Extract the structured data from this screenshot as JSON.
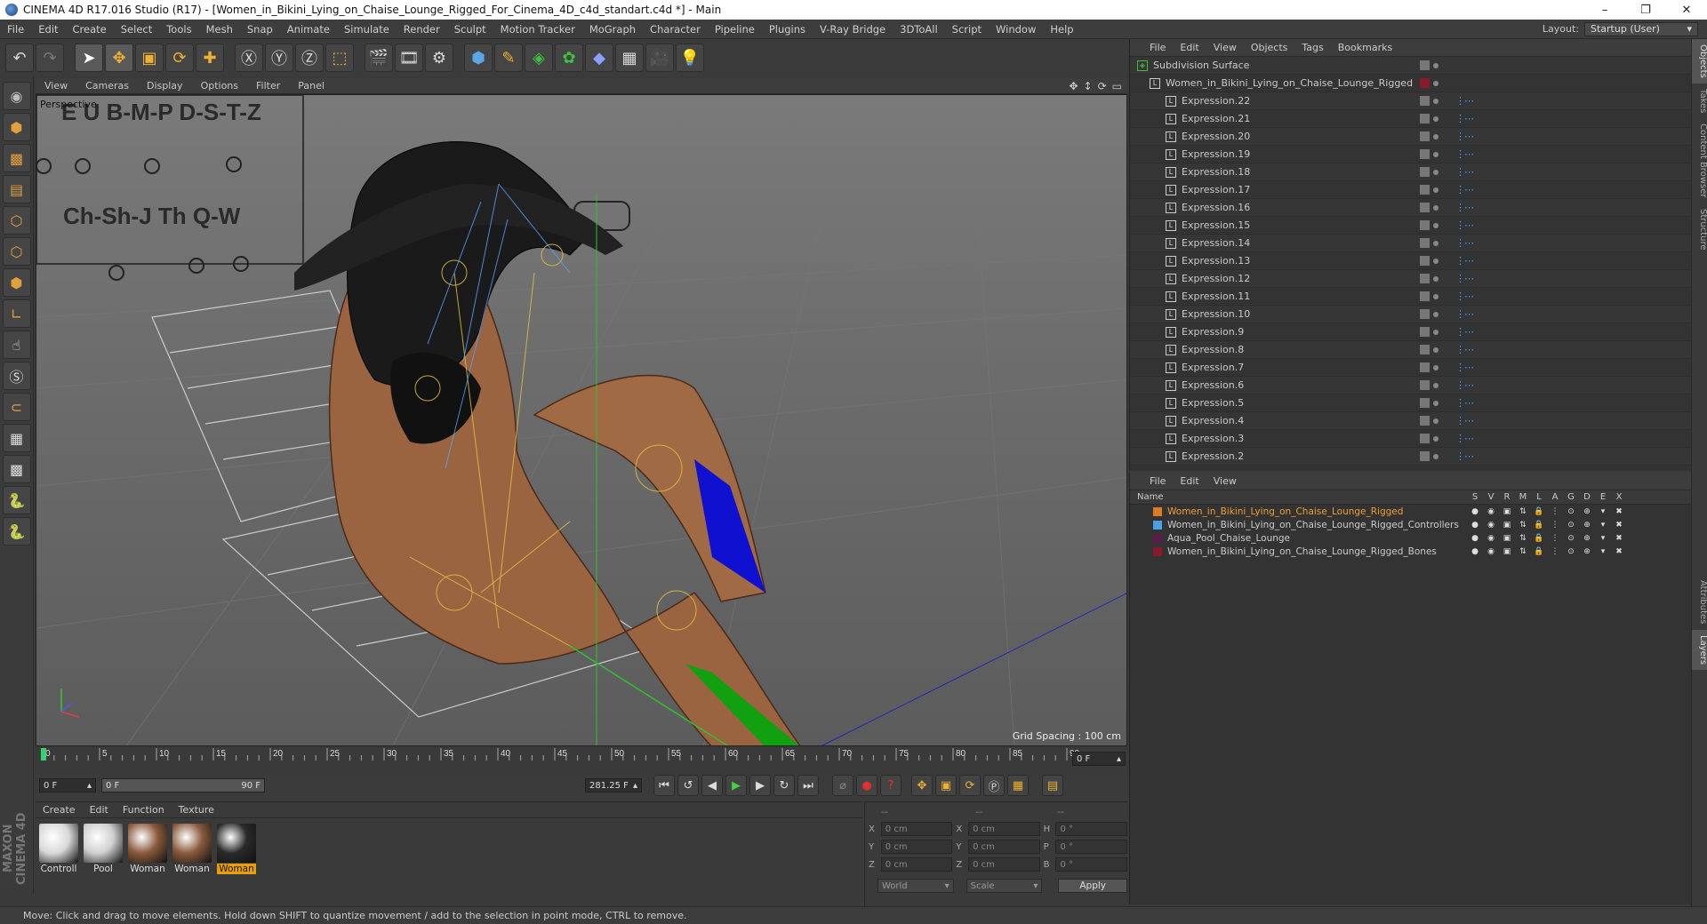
{
  "window": {
    "title": "CINEMA 4D R17.016 Studio (R17) - [Women_in_Bikini_Lying_on_Chaise_Lounge_Rigged_For_Cinema_4D_c4d_standart.c4d *] - Main",
    "minimize": "–",
    "restore": "❐",
    "close": "✕"
  },
  "menubar": {
    "items": [
      "File",
      "Edit",
      "Create",
      "Select",
      "Tools",
      "Mesh",
      "Snap",
      "Animate",
      "Simulate",
      "Render",
      "Sculpt",
      "Motion Tracker",
      "MoGraph",
      "Character",
      "Pipeline",
      "Plugins",
      "V-Ray Bridge",
      "3DToAll",
      "Script",
      "Window",
      "Help"
    ],
    "layout_label": "Layout:",
    "layout_value": "Startup (User)"
  },
  "viewport": {
    "menu": [
      "View",
      "Cameras",
      "Display",
      "Options",
      "Filter",
      "Panel"
    ],
    "label": "Perspective",
    "grid_spacing": "Grid Spacing : 100 cm",
    "phonemes_row1": "E  U   B-M-P  D-S-T-Z",
    "phonemes_row2": "Ch-Sh-J   Th   Q-W"
  },
  "timeline": {
    "ticks": [
      "0",
      "5",
      "10",
      "15",
      "20",
      "25",
      "30",
      "35",
      "40",
      "45",
      "50",
      "55",
      "60",
      "65",
      "70",
      "75",
      "80",
      "85",
      "90"
    ],
    "end_field": "0 F"
  },
  "transport": {
    "current": "0 F",
    "range_start": "0 F",
    "range_end": "90 F",
    "total": "281.25 F"
  },
  "materials": {
    "menu": [
      "Create",
      "Edit",
      "Function",
      "Texture"
    ],
    "items": [
      {
        "label": "Controll",
        "color": "#d8d8d8"
      },
      {
        "label": "Pool",
        "color": "#cfcfcf"
      },
      {
        "label": "Woman",
        "color": "#8a5a3c"
      },
      {
        "label": "Woman",
        "color": "#8a5a3c"
      },
      {
        "label": "Woman",
        "color": "#2a2a2a"
      }
    ]
  },
  "coords": {
    "header": [
      "--",
      "--",
      "--"
    ],
    "rows": [
      {
        "a": "X",
        "av": "0 cm",
        "b": "X",
        "bv": "0 cm",
        "c": "H",
        "cv": "0 °"
      },
      {
        "a": "Y",
        "av": "0 cm",
        "b": "Y",
        "bv": "0 cm",
        "c": "P",
        "cv": "0 °"
      },
      {
        "a": "Z",
        "av": "0 cm",
        "b": "Z",
        "bv": "0 cm",
        "c": "B",
        "cv": "0 °"
      }
    ],
    "world": "World",
    "scale": "Scale",
    "apply": "Apply"
  },
  "objects": {
    "menu": [
      "File",
      "Edit",
      "View",
      "Objects",
      "Tags",
      "Bookmarks"
    ],
    "root": "Subdivision Surface",
    "rig": "Women_in_Bikini_Lying_on_Chaise_Lounge_Rigged",
    "expressions": [
      "Expression.22",
      "Expression.21",
      "Expression.20",
      "Expression.19",
      "Expression.18",
      "Expression.17",
      "Expression.16",
      "Expression.15",
      "Expression.14",
      "Expression.13",
      "Expression.12",
      "Expression.11",
      "Expression.10",
      "Expression.9",
      "Expression.8",
      "Expression.7",
      "Expression.6",
      "Expression.5",
      "Expression.4",
      "Expression.3",
      "Expression.2"
    ]
  },
  "layers": {
    "menu": [
      "File",
      "Edit",
      "View"
    ],
    "name_header": "Name",
    "columns": [
      "S",
      "V",
      "R",
      "M",
      "L",
      "A",
      "G",
      "D",
      "E",
      "X"
    ],
    "items": [
      {
        "name": "Women_in_Bikini_Lying_on_Chaise_Lounge_Rigged",
        "color": "#e07a20",
        "text": "#f0a030"
      },
      {
        "name": "Women_in_Bikini_Lying_on_Chaise_Lounge_Rigged_Controllers",
        "color": "#4aa0e0",
        "text": "#cccccc"
      },
      {
        "name": "Aqua_Pool_Chaise_Lounge",
        "color": "#5a1a4a",
        "text": "#cccccc"
      },
      {
        "name": "Women_in_Bikini_Lying_on_Chaise_Lounge_Rigged_Bones",
        "color": "#8a1a2a",
        "text": "#cccccc"
      }
    ]
  },
  "sidetabs": [
    "Objects",
    "Takes",
    "Content Browser",
    "Structure",
    "Attributes",
    "Layers"
  ],
  "status": "Move: Click and drag to move elements. Hold down SHIFT to quantize movement / add to the selection in point mode, CTRL to remove.",
  "maxon": "MAXON CINEMA 4D"
}
